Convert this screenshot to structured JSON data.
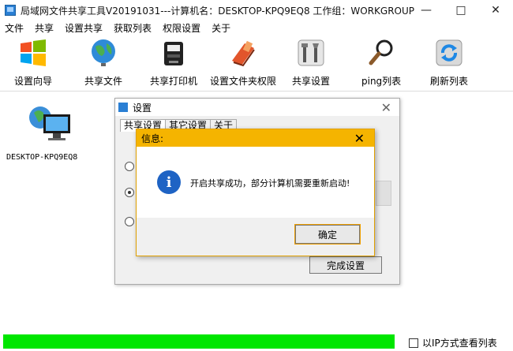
{
  "window": {
    "title": "局域网文件共享工具V20191031---计算机名：DESKTOP-KPQ9EQ8  工作组：WORKGROUP",
    "minimize": "—",
    "maximize": "□",
    "close": "✕"
  },
  "menu": [
    "文件",
    "共享",
    "设置共享",
    "获取列表",
    "权限设置",
    "关于"
  ],
  "toolbar": [
    {
      "label": "设置向导",
      "icon": "windows-logo-icon"
    },
    {
      "label": "共享文件",
      "icon": "globe-icon"
    },
    {
      "label": "共享打印机",
      "icon": "printer-icon"
    },
    {
      "label": "设置文件夹权限",
      "icon": "folder-book-icon"
    },
    {
      "label": "共享设置",
      "icon": "tools-icon"
    },
    {
      "label": "ping列表",
      "icon": "magnifier-icon"
    },
    {
      "label": "刷新列表",
      "icon": "refresh-icon"
    }
  ],
  "computer": {
    "name": "DESKTOP-KPQ9EQ8"
  },
  "settings_dialog": {
    "title": "设置",
    "close": "✕",
    "tabs": [
      "共享设置",
      "其它设置",
      "关于"
    ],
    "done_button": "完成设置"
  },
  "info_dialog": {
    "title": "信息:",
    "close": "✕",
    "message": "开启共享成功，部分计算机需要重新启动!",
    "ok_button": "确定"
  },
  "status": {
    "progress": 1.0,
    "ip_view_label": "以IP方式查看列表",
    "ip_view_checked": false
  },
  "colors": {
    "progress_fill": "#00e600",
    "dialog_title_bg": "#f5b400",
    "info_icon": "#1e63c4"
  }
}
